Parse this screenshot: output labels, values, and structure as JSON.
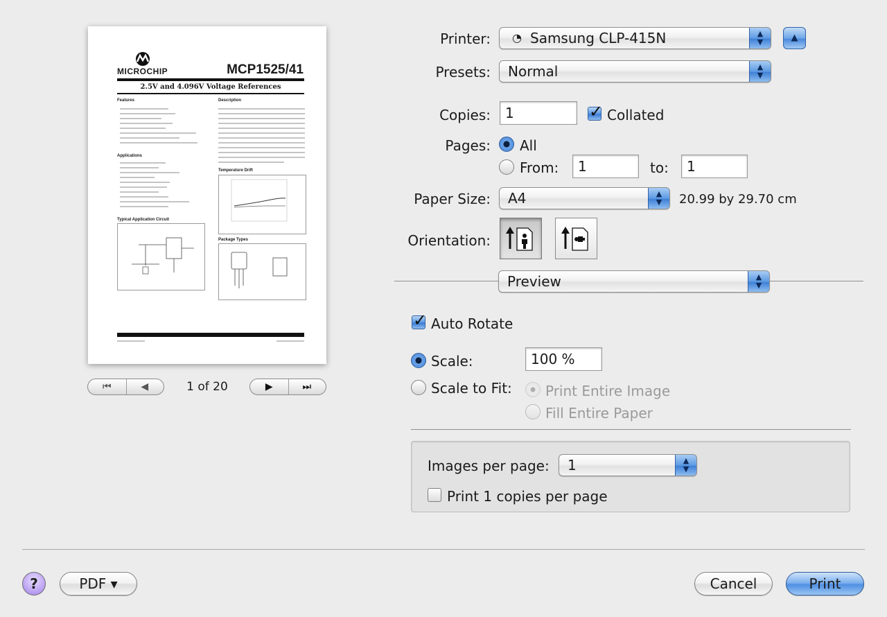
{
  "preview": {
    "doc_brand": "MICROCHIP",
    "doc_part": "MCP1525/41",
    "doc_subtitle": "2.5V and 4.096V Voltage References",
    "doc_section_features": "Features",
    "doc_section_description": "Description",
    "doc_section_applications": "Applications",
    "doc_section_circuit": "Typical Application Circuit",
    "doc_section_tempdrift": "Temperature Drift",
    "doc_section_package": "Package Types",
    "page_indicator": "1 of 20"
  },
  "printer": {
    "label": "Printer:",
    "value": "Samsung CLP-415N"
  },
  "presets": {
    "label": "Presets:",
    "value": "Normal"
  },
  "copies": {
    "label": "Copies:",
    "value": "1",
    "collated_label": "Collated",
    "collated": true
  },
  "pages": {
    "label": "Pages:",
    "all_label": "All",
    "from_label": "From:",
    "from_value": "1",
    "to_label": "to:",
    "to_value": "1",
    "selected": "all"
  },
  "paper_size": {
    "label": "Paper Size:",
    "value": "A4",
    "dimensions": "20.99 by 29.70 cm"
  },
  "orientation": {
    "label": "Orientation:",
    "selected": "portrait"
  },
  "section_popup": {
    "value": "Preview"
  },
  "auto_rotate": {
    "label": "Auto Rotate",
    "checked": true
  },
  "scale": {
    "label": "Scale:",
    "value": "100 %",
    "selected": true
  },
  "scale_to_fit": {
    "label": "Scale to Fit:",
    "print_entire_label": "Print Entire Image",
    "fill_entire_label": "Fill Entire Paper"
  },
  "images_per_page": {
    "label": "Images per page:",
    "value": "1",
    "copies_label": "Print 1 copies per page",
    "copies_checked": false
  },
  "footer": {
    "help": "?",
    "pdf_label": "PDF ▾",
    "cancel_label": "Cancel",
    "print_label": "Print"
  }
}
